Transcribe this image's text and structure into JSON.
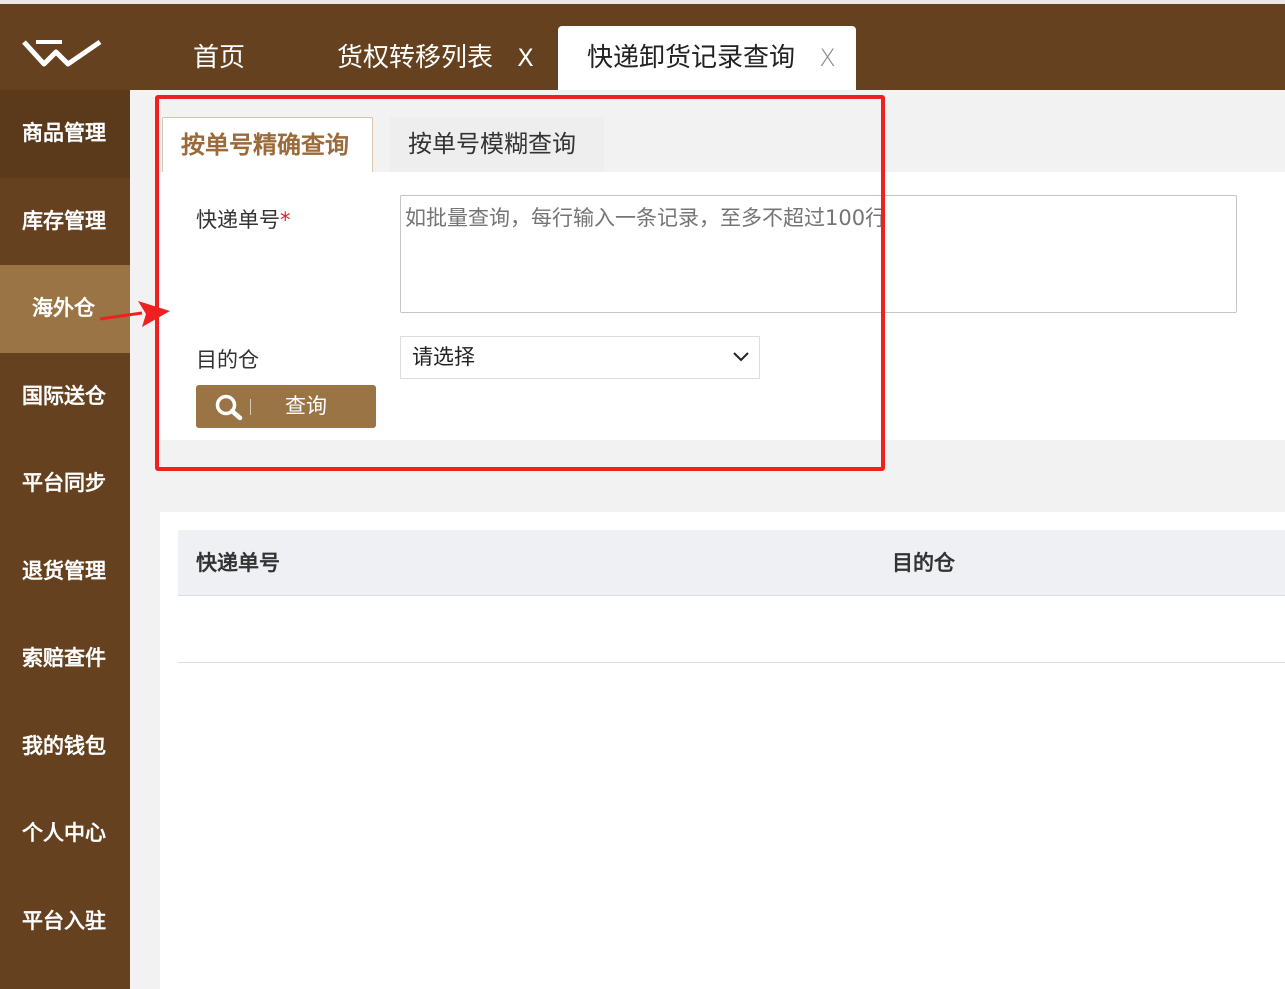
{
  "tabs": [
    {
      "label": "首页",
      "closable": false
    },
    {
      "label": "货权转移列表",
      "closable": true,
      "close": "X"
    },
    {
      "label": "快递卸货记录查询",
      "closable": true,
      "close": "X",
      "active": true
    }
  ],
  "sidebar": {
    "items": [
      {
        "label": "商品管理"
      },
      {
        "label": "库存管理"
      },
      {
        "label": "海外仓",
        "active": true
      },
      {
        "label": "国际送仓"
      },
      {
        "label": "平台同步"
      },
      {
        "label": "退货管理"
      },
      {
        "label": "索赔查件"
      },
      {
        "label": "我的钱包"
      },
      {
        "label": "个人中心"
      },
      {
        "label": "平台入驻"
      }
    ]
  },
  "query_tabs": [
    {
      "label": "按单号精确查询",
      "active": true
    },
    {
      "label": "按单号模糊查询",
      "active": false
    }
  ],
  "form": {
    "tracking_label": "快递单号",
    "required_mark": "*",
    "tracking_placeholder": "如批量查询，每行输入一条记录，至多不超过100行",
    "warehouse_label": "目的仓",
    "warehouse_value": "请选择",
    "query_button": "查询"
  },
  "table": {
    "columns": [
      "快递单号",
      "目的仓"
    ]
  },
  "colors": {
    "brand_brown": "#654120",
    "accent_tan": "#9b7445",
    "highlight_red": "#f02020"
  }
}
